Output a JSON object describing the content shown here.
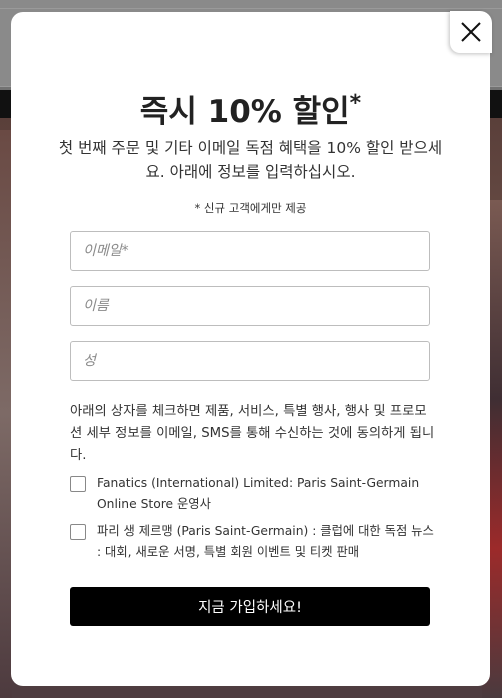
{
  "popup": {
    "title": "즉시 10% 할인",
    "title_mark": "*",
    "subtitle": "첫 번째 주문 및 기타 이메일 독점 혜택을 10% 할인 받으세요. 아래에 정보를 입력하십시오.",
    "note": "* 신규 고객에게만 제공",
    "fields": [
      {
        "placeholder": "이메일*",
        "value": ""
      },
      {
        "placeholder": "이름",
        "value": ""
      },
      {
        "placeholder": "성",
        "value": ""
      }
    ],
    "consent_text": "아래의 상자를 체크하면 제품, 서비스, 특별 행사, 행사 및 프로모션 세부 정보를 이메일, SMS를 통해 수신하는 것에 동의하게 됩니다.",
    "checkboxes": [
      {
        "label": "Fanatics (International) Limited: Paris Saint-Germain Online Store 운영사",
        "checked": false
      },
      {
        "label": "파리 생 제르맹 (Paris Saint-Germain) : 클럽에 대한 독점 뉴스 : 대회, 새로운 서명, 특별 회원 이벤트 및 티켓 판매",
        "checked": false
      }
    ],
    "submit_label": "지금 가입하세요!",
    "close_icon": "close-icon"
  },
  "colors": {
    "button_bg": "#000000",
    "overlay": "#727272"
  }
}
